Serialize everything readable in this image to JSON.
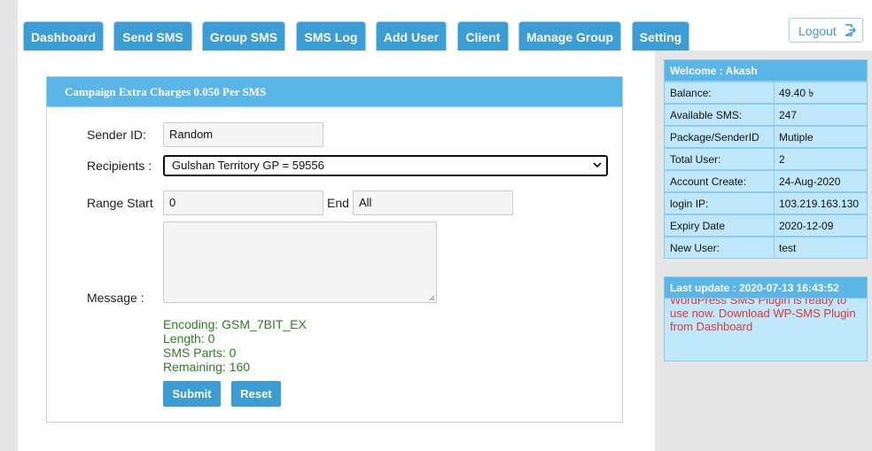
{
  "nav": {
    "tabs": [
      {
        "label": "Dashboard"
      },
      {
        "label": "Send SMS"
      },
      {
        "label": "Group SMS"
      },
      {
        "label": "SMS Log"
      },
      {
        "label": "Add User"
      },
      {
        "label": "Client"
      },
      {
        "label": "Manage Group"
      },
      {
        "label": "Setting"
      }
    ],
    "logout_label": "Logout",
    "logout_icon": "logout-icon"
  },
  "form": {
    "title": "Campaign Extra Charges 0.050 Per SMS",
    "sender_id_label": "Sender ID:",
    "sender_id_value": "Random",
    "recipients_label": "Recipients :",
    "recipients_value": "Gulshan Territory GP = 59556",
    "range_start_label": "Range Start",
    "range_start_value": "0",
    "range_end_label": "End",
    "range_end_value": "All",
    "message_label": "Message :",
    "message_value": "",
    "encoding": "Encoding: GSM_7BIT_EX",
    "length": "Length: 0",
    "sms_parts": "SMS Parts: 0",
    "remaining": "Remaining: 160",
    "submit_label": "Submit",
    "reset_label": "Reset"
  },
  "sidebar": {
    "welcome": "Welcome : Akash",
    "rows": [
      {
        "key": "Balance:",
        "value": "49.40 ৳"
      },
      {
        "key": "Available SMS:",
        "value": "247"
      },
      {
        "key": "Package/SenderID",
        "value": "Mutiple"
      },
      {
        "key": "Total User:",
        "value": "2"
      },
      {
        "key": "Account Create:",
        "value": "24-Aug-2020"
      },
      {
        "key": "login IP:",
        "value": "103.219.163.130"
      },
      {
        "key": "Expiry Date",
        "value": "2020-12-09"
      },
      {
        "key": "New User:",
        "value": "test"
      }
    ],
    "last_update": "Last update : 2020-07-13 16:43:52",
    "notice": "WordPress SMS Plugin is ready to use now. Download WP-SMS Plugin from Dashboard"
  },
  "colors": {
    "accent": "#3b9dd3",
    "panel_header": "#5bb6e8",
    "sidebar_row": "#bfe7fa",
    "notice_text": "#e23535",
    "info_text": "#2e7d22"
  }
}
